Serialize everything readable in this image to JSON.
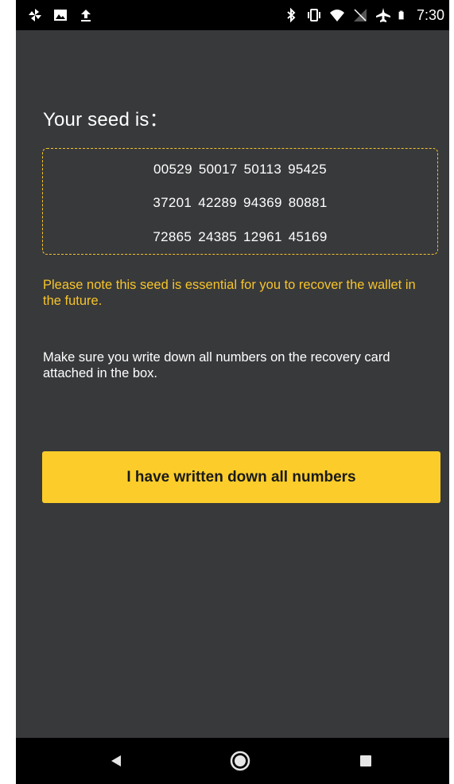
{
  "status_bar": {
    "left_icons": [
      "pinwheel-icon",
      "image-icon",
      "upload-icon"
    ],
    "right_icons": [
      "bluetooth-icon",
      "vibrate-icon",
      "wifi-icon",
      "no-signal-icon",
      "airplane-icon",
      "battery-icon"
    ],
    "time": "7:30"
  },
  "main": {
    "title": "Your seed is：",
    "seed_rows": [
      "00529 50017 50113 95425",
      "37201 42289 94369 80881",
      "72865 24385 12961 45169"
    ],
    "warning": "Please note this seed is essential for you to recover the wallet in the future.",
    "note": "Make sure you write down all numbers on the recovery card attached in the box.",
    "confirm_label": "I have written down all numbers"
  },
  "nav_bar": {
    "buttons": [
      "back-icon",
      "home-icon",
      "recents-icon"
    ]
  },
  "colors": {
    "background": "#38393b",
    "accent": "#fccd2a",
    "warning_text": "#f6c42a",
    "bars": "#000000"
  }
}
